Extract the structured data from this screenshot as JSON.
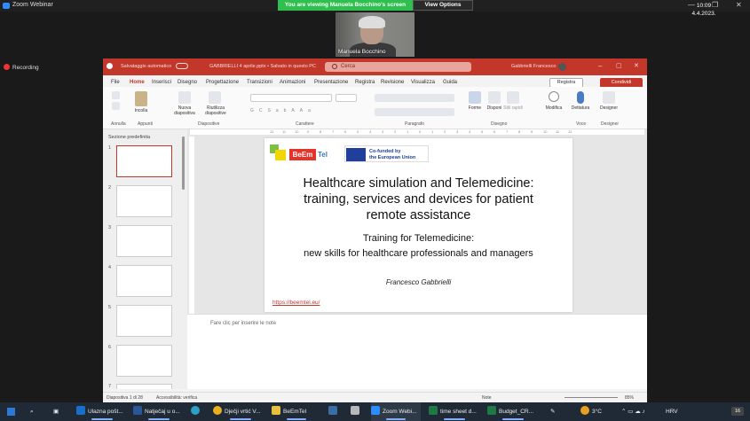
{
  "zoom": {
    "title": "Zoom Webinar",
    "banner": "You are viewing Manuela Bocchino's screen",
    "view_options": "View Options",
    "camera_name": "Manuela Bocchino",
    "recording": "Recording"
  },
  "ppt": {
    "autosave": "Salvataggio automatico",
    "doc_title": "GABBRIELLI 4 aprile.pptx • Salvato in questo PC",
    "search_placeholder": "Cerca",
    "user": "Gabbrielli Francesco",
    "menu": [
      "File",
      "Home",
      "Inserisci",
      "Disegno",
      "Progettazione",
      "Transizioni",
      "Animazioni",
      "Presentazione",
      "Registra",
      "Revisione",
      "Visualizza",
      "Guida"
    ],
    "record_btn": "Registra",
    "share_btn": "Condividi",
    "ribbon": {
      "incolla": "Incolla",
      "nuova": "Nuova diapositiva",
      "riutilizza": "Riutilizza diapositive",
      "forme": "Forme",
      "disponi": "Disponi",
      "stili": "Stili rapidi",
      "modifica": "Modifica",
      "dettatura": "Dettatura",
      "designer": "Designer",
      "groups": [
        "Annulla",
        "Appunti",
        "Diapositive",
        "Carattere",
        "Paragrafo",
        "Disegno",
        "Voce",
        "Designer"
      ]
    },
    "section": "Sezione predefinita",
    "thumb_numbers": [
      "1",
      "2",
      "3",
      "4",
      "5",
      "6",
      "7"
    ],
    "ruler": [
      "12",
      "11",
      "10",
      "9",
      "8",
      "7",
      "6",
      "5",
      "4",
      "3",
      "2",
      "1",
      "0",
      "1",
      "2",
      "3",
      "4",
      "5",
      "6",
      "7",
      "8",
      "9",
      "10",
      "11",
      "12"
    ],
    "slide": {
      "logo_be": "BeEm",
      "logo_tel": "Tel",
      "eu_text_1": "Co-funded by",
      "eu_text_2": "the European Union",
      "title_1": "Healthcare simulation and Telemedicine:",
      "title_2": "training, services and devices for patient",
      "title_3": "remote assistance",
      "subtitle_1": "Training for Telemedicine:",
      "subtitle_2": "new skills for healthcare professionals and managers",
      "author": "Francesco Gabbrielli",
      "link": "https://beemtel.eu/"
    },
    "notes_placeholder": "Fare clic per inserire le note",
    "status_slide": "Diapositiva 1 di 28",
    "status_access": "Accessibilità: verifica",
    "status_notes": "Note",
    "status_zoom": "85%"
  },
  "taskbar": {
    "items": [
      "Ulazna pošt...",
      "Natječaj u o...",
      "Dječji vrtić V...",
      "BeEmTel",
      "Zoom Webi...",
      "time sheet d...",
      "Budget_CR..."
    ],
    "weather": "3°C",
    "lang": "HRV",
    "time": "10:09",
    "date": "4.4.2023.",
    "notif": "16"
  }
}
